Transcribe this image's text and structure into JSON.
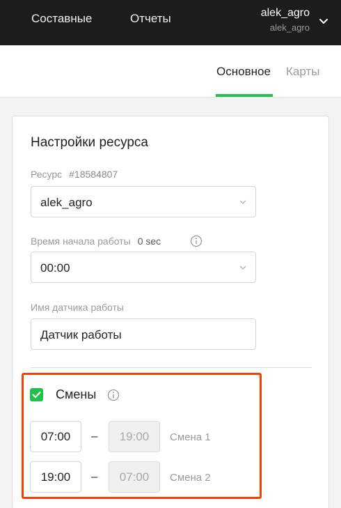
{
  "header": {
    "nav": [
      "Составные",
      "Отчеты"
    ],
    "user": {
      "name": "alek_agro",
      "login": "alek_agro"
    },
    "user_menu_icon": "chevron-down-icon"
  },
  "tabs": [
    {
      "label": "Основное",
      "active": true
    },
    {
      "label": "Карты",
      "active": false
    }
  ],
  "colors": {
    "accent": "#1fc14a",
    "highlight": "#ff3b00",
    "header_bg": "#1c1c1c"
  },
  "card": {
    "title": "Настройки ресурса",
    "resource": {
      "label": "Ресурс",
      "id": "#18584807",
      "value": "alek_agro"
    },
    "start_time": {
      "label": "Время начала работы",
      "offset": "0 sec",
      "value": "00:00"
    },
    "sensor": {
      "label": "Имя датчика работы",
      "value": "Датчик работы"
    },
    "shifts": {
      "label": "Смены",
      "enabled": true,
      "items": [
        {
          "start": "07:00",
          "end": "19:00",
          "name": "Смена 1"
        },
        {
          "start": "19:00",
          "end": "07:00",
          "name": "Смена 2"
        }
      ],
      "separator": "–"
    }
  }
}
